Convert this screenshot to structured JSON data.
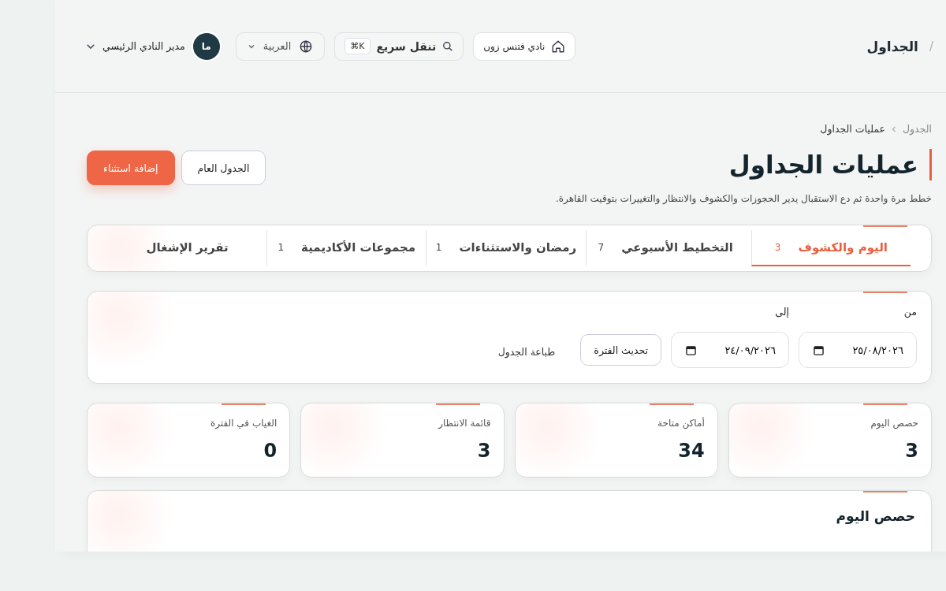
{
  "topbar": {
    "separator": "/",
    "title": "الجداول",
    "club": "نادي فتنس زون",
    "quick_nav": {
      "label": "تنقل سريع",
      "shortcut": "⌘K"
    },
    "language": "العربية",
    "user": {
      "initials": "ما",
      "name": "مدير النادي الرئيسي"
    }
  },
  "breadcrumb": [
    {
      "label": "الجدول",
      "current": false
    },
    {
      "label": "عمليات الجداول",
      "current": true
    }
  ],
  "page": {
    "title": "عمليات الجداول",
    "subtitle": "خطط مرة واحدة ثم دع الاستقبال يدير الحجوزات والكشوف والانتظار والتغييرات بتوقيت القاهرة.",
    "actions": [
      {
        "label": "الجدول العام",
        "kind": "secondary"
      },
      {
        "label": "إضافة استثناء",
        "kind": "primary"
      }
    ]
  },
  "tabs": [
    {
      "label": "اليوم والكشوف",
      "count": "3",
      "selected": true
    },
    {
      "label": "التخطيط الأسبوعي",
      "count": "7",
      "selected": false
    },
    {
      "label": "رمضان والاستثناءات",
      "count": "1",
      "selected": false
    },
    {
      "label": "مجموعات الأكاديمية",
      "count": "1",
      "selected": false
    },
    {
      "label": "تقرير الإشغال",
      "selected": false
    }
  ],
  "filters": {
    "from": {
      "label": "من",
      "value": "٢٥/٠٨/٢٠٢٦"
    },
    "to": {
      "label": "إلى",
      "value": "٢٤/٠٩/٢٠٢٦"
    },
    "refresh": "تحديث الفترة",
    "print": "طباعة الجدول"
  },
  "stats": [
    {
      "label": "حصص اليوم",
      "value": "3"
    },
    {
      "label": "أماكن متاحة",
      "value": "34"
    },
    {
      "label": "قائمة الانتظار",
      "value": "3"
    },
    {
      "label": "الغياب في الفترة",
      "value": "0"
    }
  ],
  "section": {
    "title": "حصص اليوم"
  }
}
